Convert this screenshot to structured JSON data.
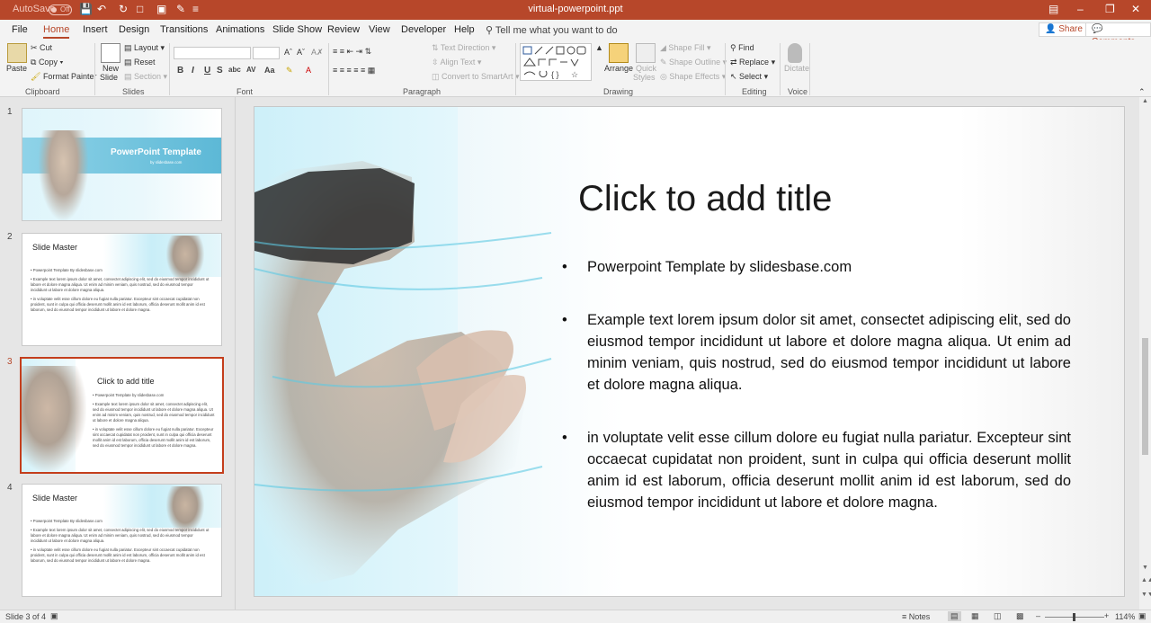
{
  "titlebar": {
    "autosave": "AutoSave",
    "toggle": "Off",
    "doc_title": "virtual-powerpoint.ppt"
  },
  "tabs": [
    "File",
    "Home",
    "Insert",
    "Design",
    "Transitions",
    "Animations",
    "Slide Show",
    "Review",
    "View",
    "Developer",
    "Help"
  ],
  "tell_me": "Tell me what you want to do",
  "share": "Share",
  "comments": "Comments",
  "ribbon": {
    "clipboard": {
      "paste": "Paste",
      "cut": "Cut",
      "copy": "Copy",
      "format_painter": "Format Painter",
      "label": "Clipboard"
    },
    "slides": {
      "new_slide": "New",
      "new_slide2": "Slide",
      "layout": "Layout",
      "reset": "Reset",
      "section": "Section",
      "label": "Slides"
    },
    "font": {
      "label": "Font",
      "bold": "B",
      "italic": "I",
      "underline": "U",
      "strike": "S",
      "shadow": "abc",
      "spacing": "AV",
      "case": "Aa"
    },
    "paragraph": {
      "text_direction": "Text Direction",
      "align_text": "Align Text",
      "convert": "Convert to SmartArt",
      "label": "Paragraph"
    },
    "drawing": {
      "arrange": "Arrange",
      "quick_styles": "Quick",
      "quick_styles2": "Styles",
      "shape_fill": "Shape Fill",
      "shape_outline": "Shape Outline",
      "shape_effects": "Shape Effects",
      "label": "Drawing"
    },
    "editing": {
      "find": "Find",
      "replace": "Replace",
      "select": "Select",
      "label": "Editing"
    },
    "voice": {
      "dictate": "Dictate",
      "label": "Voice"
    }
  },
  "thumbnails": [
    {
      "num": "1",
      "title": "PowerPoint Template",
      "subtitle": "by slidesbase.com"
    },
    {
      "num": "2",
      "title": "Slide Master",
      "lines": [
        "Powerpoint Template By slidesbase.com",
        "Example text lorem ipsum dolor sit amet, consectet adipiscing elit, sed do eiusmod tempor incididunt ut labore et dolore magna aliqua. Ut enim ad minim veniam, quis nostrud, sed do eiusmod tempor incididunt ut labore et dolore magna aliqua.",
        "in voluptate velit esse cillum dolore eu fugiat nulla pariatur. Excepteur sint occaecat cupidatat non proident, sunt in culpa qui officia deserunt mollit anim id est laborum, officia deserunt mollit anim id est laborum, sed do eiusmod tempor incididunt ut labore et dolore magna."
      ]
    },
    {
      "num": "3",
      "title": "Click to add title",
      "lines": [
        "Powerpoint Template by slidesbase.com",
        "Example text lorem ipsum dolor sit amet, consectet adipiscing elit, sed do eiusmod tempor incididunt ut labore et dolore magna aliqua. Ut enim ad minim veniam, quis nostrud, sed do eiusmod tempor incididunt ut labore et dolore magna aliqua.",
        "in voluptate velit esse cillum dolore eu fugiat nulla pariatur. Excepteur sint occaecat cupidatat non proident, sunt in culpa qui officia deserunt mollit anim id est laborum, officia deserunt mollit anim id est laborum, sed do eiusmod tempor incididunt ut labore et dolore magna."
      ]
    },
    {
      "num": "4",
      "title": "Slide Master",
      "lines": [
        "Powerpoint Template By slidesbase.com",
        "Example text lorem ipsum dolor sit amet, consectet adipiscing elit, sed do eiusmod tempor incididunt ut labore et dolore magna aliqua. Ut enim ad minim veniam, quis nostrud, sed do eiusmod tempor incididunt ut labore et dolore magna aliqua.",
        "in voluptate velit esse cillum dolore eu fugiat nulla pariatur. Excepteur sint occaecat cupidatat non proident, sunt in culpa qui officia deserunt mollit anim id est laborum, officia deserunt mollit anim id est laborum, sed do eiusmod tempor incididunt ut labore et dolore magna."
      ]
    }
  ],
  "slide": {
    "title": "Click to add title",
    "bullets": [
      "Powerpoint Template by slidesbase.com",
      "Example text lorem ipsum dolor sit amet, consectet adipiscing elit, sed do eiusmod tempor incididunt ut labore et dolore magna aliqua. Ut enim ad minim veniam, quis nostrud, sed do eiusmod tempor incididunt ut labore et dolore magna aliqua.",
      "in voluptate velit esse cillum dolore eu fugiat nulla pariatur. Excepteur sint occaecat cupidatat non proident, sunt in culpa qui officia deserunt mollit anim id est laborum, officia deserunt mollit anim id est laborum, sed do eiusmod tempor incididunt ut labore et dolore magna."
    ]
  },
  "status": {
    "slide_count": "Slide 3 of 4",
    "notes": "Notes",
    "zoom": "114%"
  },
  "colors": {
    "accent": "#b7472a",
    "selection": "#c43e1c"
  }
}
